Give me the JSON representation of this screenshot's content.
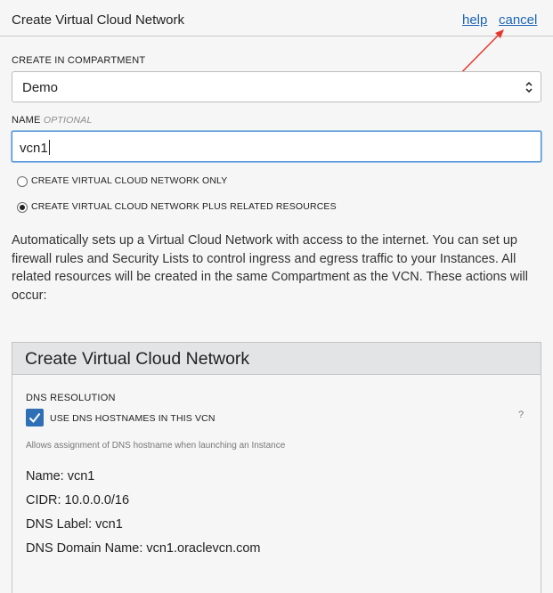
{
  "header": {
    "title": "Create Virtual Cloud Network",
    "help_label": "help",
    "cancel_label": "cancel"
  },
  "compartment": {
    "label": "CREATE IN COMPARTMENT",
    "selected": "Demo"
  },
  "name_field": {
    "label": "NAME",
    "optional_label": "OPTIONAL",
    "value": "vcn1"
  },
  "options": [
    {
      "label": "CREATE VIRTUAL CLOUD NETWORK ONLY",
      "checked": false
    },
    {
      "label": "CREATE VIRTUAL CLOUD NETWORK PLUS RELATED RESOURCES",
      "checked": true
    }
  ],
  "description": "Automatically sets up a Virtual Cloud Network with access to the internet. You can set up firewall rules and Security Lists to control ingress and egress traffic to your Instances. All related resources will be created in the same Compartment as the VCN. These actions will occur:",
  "panel": {
    "title": "Create Virtual Cloud Network",
    "dns_resolution_label": "DNS RESOLUTION",
    "checkbox_label": "USE DNS HOSTNAMES IN THIS VCN",
    "checkbox_checked": true,
    "help_mark": "?",
    "hint": "Allows assignment of DNS hostname when launching an Instance",
    "details": {
      "name": "Name: vcn1",
      "cidr": "CIDR: 10.0.0.0/16",
      "dns_label": "DNS Label: vcn1",
      "dns_domain": "DNS Domain Name: vcn1.oraclevcn.com"
    }
  },
  "colors": {
    "link": "#1a64b5",
    "checkbox": "#2f6fb5",
    "annotation_arrow": "#e5382e"
  }
}
